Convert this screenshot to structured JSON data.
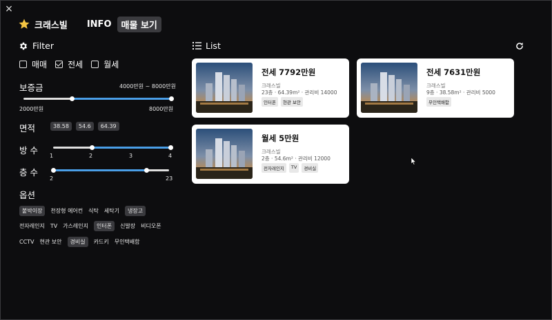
{
  "header": {
    "close_icon": "×",
    "brand": "크래스빌",
    "tabs": [
      {
        "label": "INFO",
        "active": false
      },
      {
        "label": "매물 보기",
        "active": true
      }
    ]
  },
  "filter": {
    "title": "Filter",
    "deal_types": [
      {
        "label": "매매",
        "checked": false
      },
      {
        "label": "전세",
        "checked": true
      },
      {
        "label": "월세",
        "checked": false
      }
    ],
    "deposit": {
      "label": "보증금",
      "summary": "4000만원 ~ 8000만원",
      "min_label": "2000만원",
      "max_label": "8000만원",
      "low_fraction": 0.33,
      "high_fraction": 1.0
    },
    "area": {
      "label": "면적",
      "options": [
        "38.58",
        "54.6",
        "64.39"
      ]
    },
    "rooms": {
      "label": "방 수",
      "ticks": [
        "1",
        "2",
        "3",
        "4"
      ],
      "low": 2,
      "high": 4,
      "min": 1,
      "max": 4
    },
    "floors": {
      "label": "층 수",
      "min_label": "2",
      "max_label": "23",
      "low": 2,
      "high": 19,
      "min": 2,
      "max": 23
    },
    "options": {
      "label": "옵션",
      "rows": [
        [
          {
            "label": "붙박이장",
            "on": true
          },
          {
            "label": "천장형 에어컨",
            "on": false
          },
          {
            "label": "식탁",
            "on": false
          },
          {
            "label": "세탁기",
            "on": false
          },
          {
            "label": "냉장고",
            "on": true
          }
        ],
        [
          {
            "label": "전자레인지",
            "on": false
          },
          {
            "label": "TV",
            "on": false
          },
          {
            "label": "가스레인지",
            "on": false
          },
          {
            "label": "인터폰",
            "on": true
          },
          {
            "label": "신발장",
            "on": false
          },
          {
            "label": "비디오폰",
            "on": false
          }
        ],
        [
          {
            "label": "CCTV",
            "on": false
          },
          {
            "label": "현관 보안",
            "on": false
          },
          {
            "label": "경비실",
            "on": true
          },
          {
            "label": "카드키",
            "on": false
          },
          {
            "label": "무인택배함",
            "on": false
          }
        ]
      ]
    }
  },
  "list": {
    "title": "List",
    "refresh_icon": "refresh-icon",
    "cards": [
      {
        "price": "전세  7792만원",
        "building": "크래스빌",
        "detail": "23층 · 64.39m² · 관리비 14000",
        "tags": [
          "인터폰",
          "현관 보안"
        ]
      },
      {
        "price": "전세  7631만원",
        "building": "크래스빌",
        "detail": "9층 · 38.58m² · 관리비 5000",
        "tags": [
          "무인택배함"
        ]
      },
      {
        "price": "월세  5만원",
        "building": "크래스빌",
        "detail": "2층 · 54.6m² · 관리비 12000",
        "tags": [
          "전자레인지",
          "TV",
          "경비실"
        ]
      }
    ]
  },
  "colors": {
    "background": "#0d0d0f",
    "accent": "#4a9fe8",
    "star": "#f5c542",
    "chip": "#3a3a3e"
  }
}
